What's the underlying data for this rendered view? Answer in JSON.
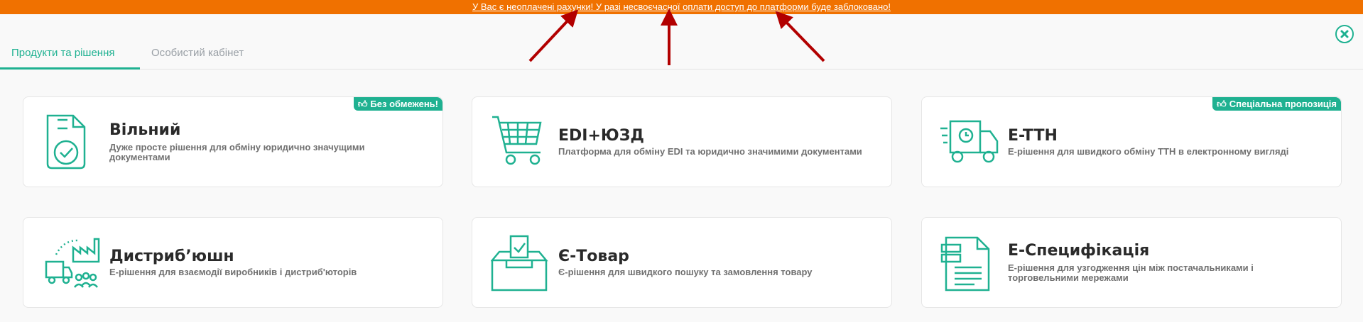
{
  "banner": {
    "text": "У Вас є неоплачені рахунки! У разі несвоєчасної оплати доступ до платформи буде заблоковано!",
    "color": "#f07100"
  },
  "tabs": [
    {
      "label": "Продукти та рішення",
      "active": true
    },
    {
      "label": "Особистий кабінет",
      "active": false
    }
  ],
  "accent_color": "#1fb191",
  "arrow_color": "#b20000",
  "cards": [
    {
      "title": "Вільний",
      "description": "Дуже просте рішення для обміну юридично значущими документами",
      "badge": "Без обмежень!",
      "icon": "document-check-icon"
    },
    {
      "title": "EDI+ЮЗД",
      "description": "Платформа для обміну EDI та юридично значимими документами",
      "badge": "",
      "icon": "shopping-cart-icon"
    },
    {
      "title": "E-TTH",
      "description": "Е-рішення для швидкого обміну ТТН в електронному вигляді",
      "badge": "Спеціальна пропозиція",
      "icon": "delivery-truck-icon"
    },
    {
      "title": "Дистриб’юшн",
      "description": "Е-рішення для взаємодії виробників і дистриб'юторів",
      "badge": "",
      "icon": "factory-distribution-icon"
    },
    {
      "title": "Є-Товар",
      "description": "Є-рішення для швидкого пошуку та замовлення товару",
      "badge": "",
      "icon": "ballot-box-icon"
    },
    {
      "title": "Е-Специфікація",
      "description": "Е-рішення для узгодження цін між постачальниками і торговельними мережами",
      "badge": "",
      "icon": "specification-document-icon"
    }
  ]
}
